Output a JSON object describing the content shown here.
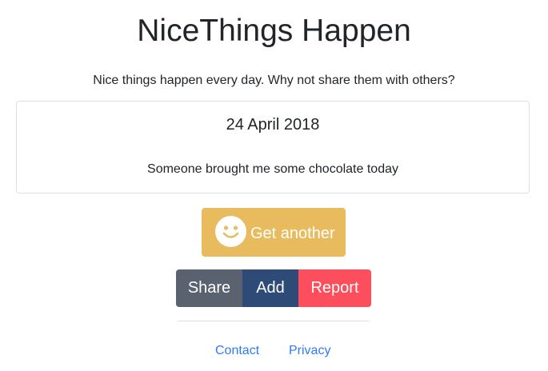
{
  "header": {
    "title": "NiceThings Happen",
    "subtitle": "Nice things happen every day. Why not share them with others?"
  },
  "card": {
    "date": "24 April 2018",
    "text": "Someone brought me some chocolate today"
  },
  "get_another": {
    "label": "Get another",
    "icon": "smiley-icon",
    "color": "#e8bc5e"
  },
  "actions": {
    "share_label": "Share",
    "add_label": "Add",
    "report_label": "Report",
    "share_color": "#5a6270",
    "add_color": "#2e4a76",
    "report_color": "#fd4e5d"
  },
  "footer": {
    "contact_label": "Contact",
    "privacy_label": "Privacy",
    "link_color": "#2f7bf5"
  }
}
